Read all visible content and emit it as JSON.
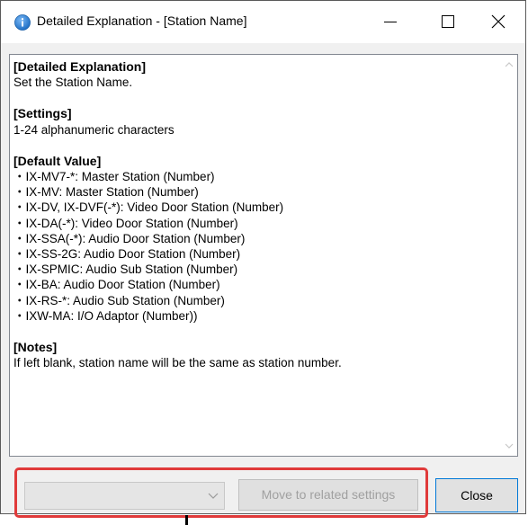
{
  "window": {
    "title": "Detailed Explanation - [Station Name]",
    "controls": [
      "minimize",
      "maximize",
      "close"
    ]
  },
  "content": {
    "sections": [
      {
        "heading": "[Detailed Explanation]",
        "lines": [
          "Set the Station Name."
        ]
      },
      {
        "heading": "[Settings]",
        "lines": [
          "1-24 alphanumeric characters"
        ]
      },
      {
        "heading": "[Default Value]",
        "lines": [
          "・IX-MV7-*: Master Station (Number)",
          "・IX-MV: Master Station (Number)",
          "・IX-DV, IX-DVF(-*): Video Door Station (Number)",
          "・IX-DA(-*): Video Door Station (Number)",
          "・IX-SSA(-*): Audio Door Station (Number)",
          "・IX-SS-2G: Audio Door Station (Number)",
          "・IX-SPMIC: Audio Sub Station (Number)",
          "・IX-BA: Audio Door Station (Number)",
          "・IX-RS-*: Audio Sub Station (Number)",
          "・IXW-MA: I/O Adaptor (Number))"
        ]
      },
      {
        "heading": "[Notes]",
        "lines": [
          "If left blank, station name will be the same as station number."
        ]
      }
    ]
  },
  "footer": {
    "dropdown_value": "",
    "move_button_label": "Move to related settings",
    "move_button_enabled": false,
    "close_button_label": "Close"
  },
  "colors": {
    "highlight": "#e03a3a",
    "close_border": "#0078d7",
    "info_icon": "#2f7fd6"
  }
}
